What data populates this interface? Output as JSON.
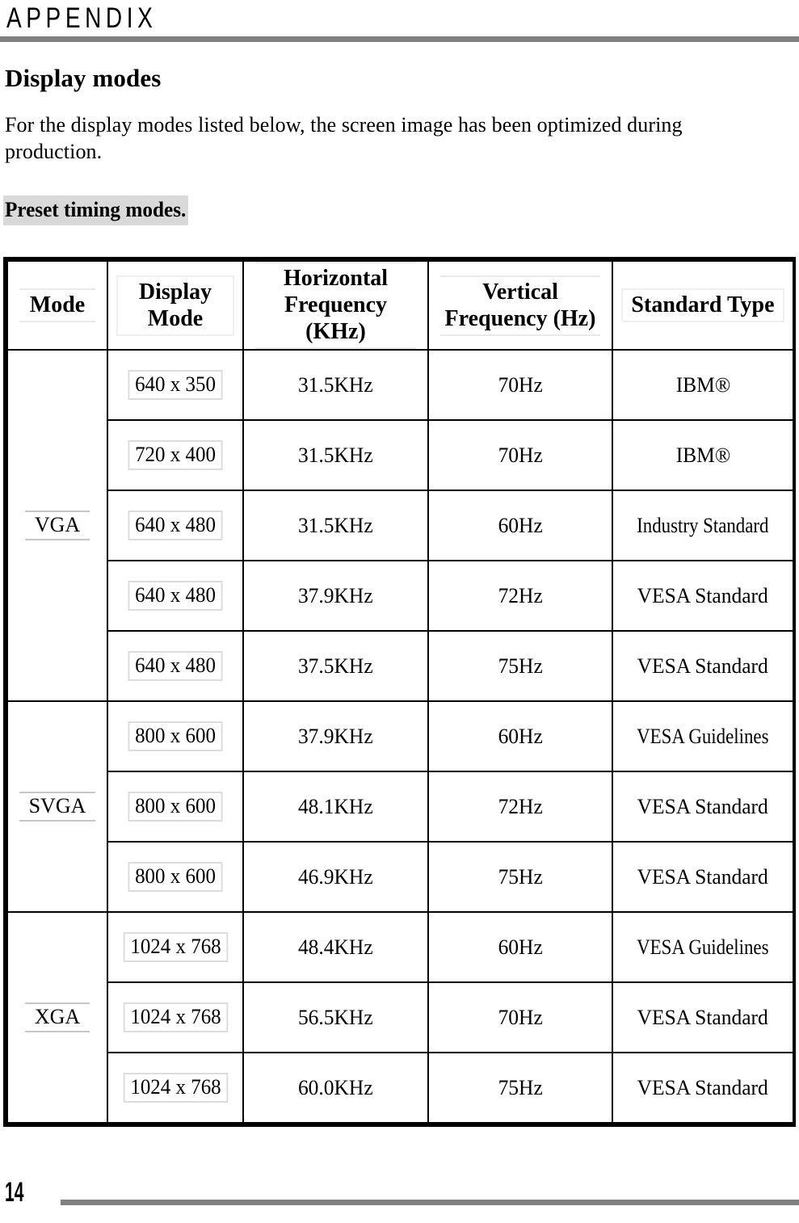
{
  "header": {
    "running_head": "APPENDIX",
    "section_title": "Display modes",
    "intro": "For the display modes listed below, the screen image has been optimized during production.",
    "subhead": "Preset timing modes."
  },
  "table": {
    "columns": [
      "Mode",
      "Display\nMode",
      "Horizontal\nFrequency (KHz)",
      "Vertical\nFrequency (Hz)",
      "Standard Type"
    ],
    "column_headers": {
      "mode": "Mode",
      "display_mode_line1": "Display",
      "display_mode_line2": "Mode",
      "horizontal_line1": "Horizontal",
      "horizontal_line2": "Frequency (KHz)",
      "vertical_line1": "Vertical",
      "vertical_line2": "Frequency (Hz)",
      "standard_type": "Standard Type"
    },
    "groups": [
      {
        "name": "VGA",
        "rows": [
          {
            "display_mode": "640 x 350",
            "h_freq": "31.5KHz",
            "v_freq": "70Hz",
            "standard": "IBM®"
          },
          {
            "display_mode": "720 x 400",
            "h_freq": "31.5KHz",
            "v_freq": "70Hz",
            "standard": "IBM®"
          },
          {
            "display_mode": "640 x 480",
            "h_freq": "31.5KHz",
            "v_freq": "60Hz",
            "standard": "Industry Standard"
          },
          {
            "display_mode": "640 x 480",
            "h_freq": "37.9KHz",
            "v_freq": "72Hz",
            "standard": "VESA Standard"
          },
          {
            "display_mode": "640 x 480",
            "h_freq": "37.5KHz",
            "v_freq": "75Hz",
            "standard": "VESA Standard"
          }
        ]
      },
      {
        "name": "SVGA",
        "rows": [
          {
            "display_mode": "800 x 600",
            "h_freq": "37.9KHz",
            "v_freq": "60Hz",
            "standard": "VESA Guidelines"
          },
          {
            "display_mode": "800 x 600",
            "h_freq": "48.1KHz",
            "v_freq": "72Hz",
            "standard": "VESA Standard"
          },
          {
            "display_mode": "800 x 600",
            "h_freq": "46.9KHz",
            "v_freq": "75Hz",
            "standard": "VESA Standard"
          }
        ]
      },
      {
        "name": "XGA",
        "rows": [
          {
            "display_mode": "1024 x 768",
            "h_freq": "48.4KHz",
            "v_freq": "60Hz",
            "standard": "VESA Guidelines"
          },
          {
            "display_mode": "1024 x 768",
            "h_freq": "56.5KHz",
            "v_freq": "70Hz",
            "standard": "VESA Standard"
          },
          {
            "display_mode": "1024 x 768",
            "h_freq": "60.0KHz",
            "v_freq": "75Hz",
            "standard": "VESA Standard"
          }
        ]
      }
    ]
  },
  "footer": {
    "page_number": "14"
  },
  "colors": {
    "rule": "#808080",
    "header_mode_fill": "#b3b3b3",
    "header_display_fill": "#cccccc",
    "header_light_fill": "#e8e8e8",
    "group_fill": "#b3b3b3",
    "display_cell_fill": "#cccccc",
    "subhead_highlight": "#d9d9d9",
    "border": "#000000"
  }
}
